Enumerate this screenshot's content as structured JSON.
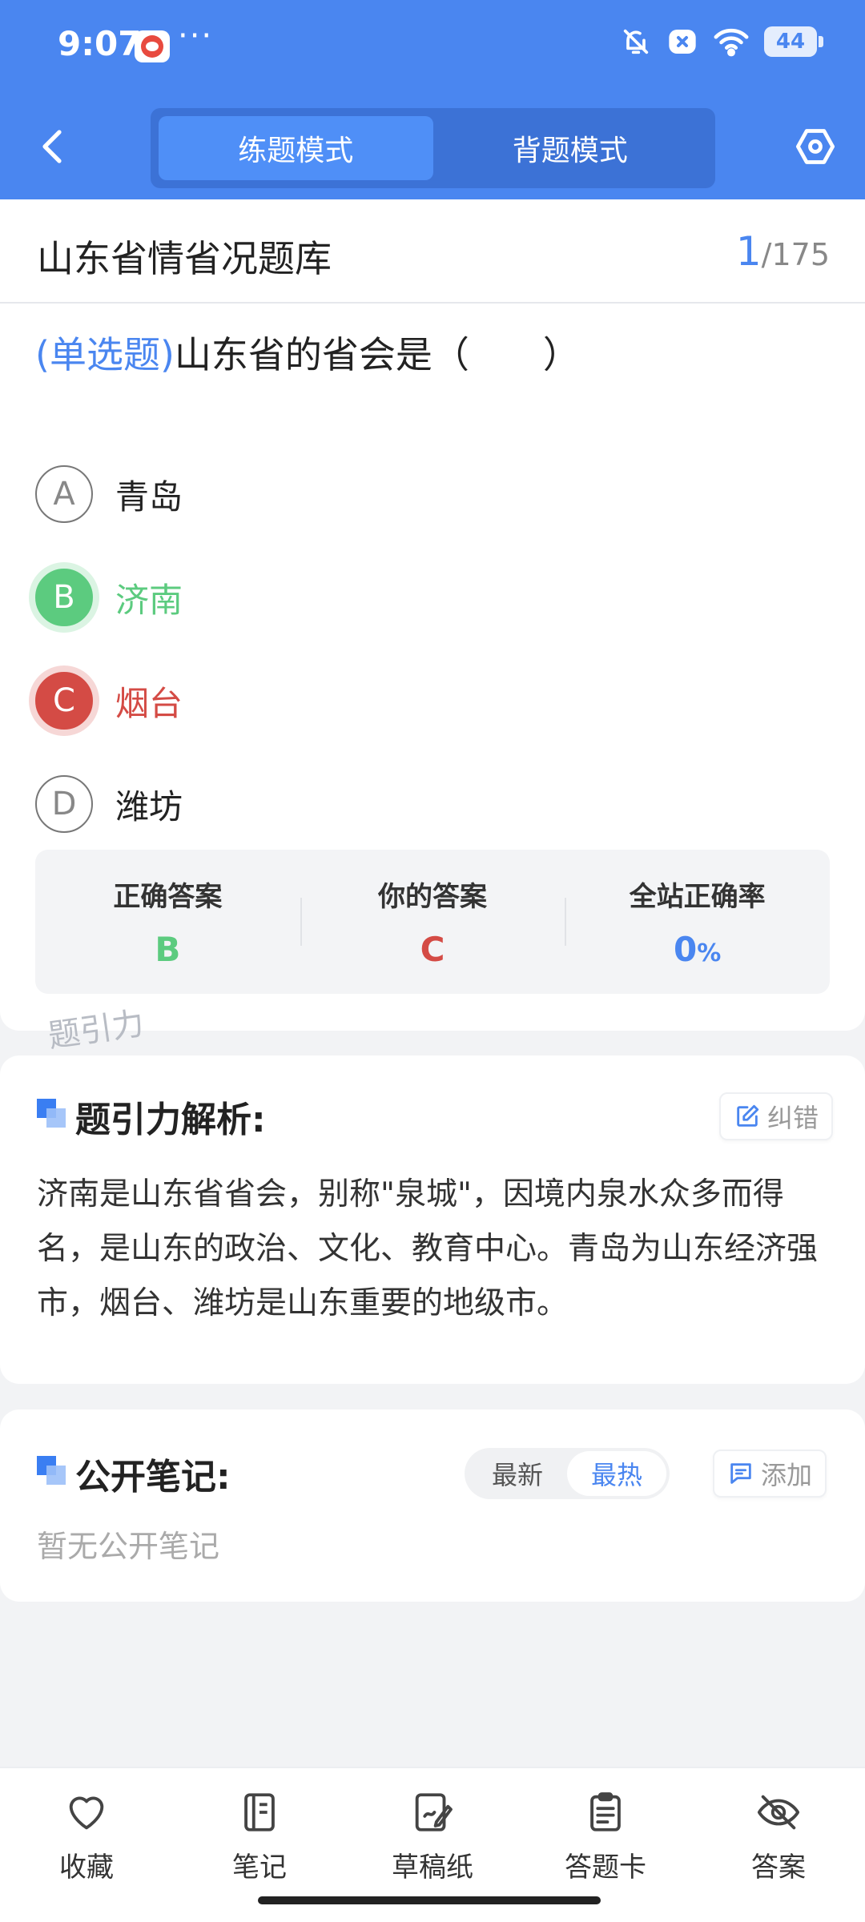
{
  "status_bar": {
    "time": "9:07",
    "more": "···",
    "battery": "44"
  },
  "nav": {
    "tabs": [
      {
        "label": "练题模式",
        "active": true
      },
      {
        "label": "背题模式",
        "active": false
      }
    ]
  },
  "bank": {
    "title": "山东省情省况题库",
    "current": "1",
    "total": "/175"
  },
  "question": {
    "type": "(单选题)",
    "text": "山东省的省会是（　　）",
    "options": [
      {
        "letter": "A",
        "text": "青岛",
        "state": "normal"
      },
      {
        "letter": "B",
        "text": "济南",
        "state": "correct"
      },
      {
        "letter": "C",
        "text": "烟台",
        "state": "wrong"
      },
      {
        "letter": "D",
        "text": "潍坊",
        "state": "normal"
      }
    ]
  },
  "stats": {
    "correct_label": "正确答案",
    "correct_value": "B",
    "yours_label": "你的答案",
    "yours_value": "C",
    "rate_label": "全站正确率",
    "rate_value": "0",
    "rate_unit": "%"
  },
  "watermark": "题引力",
  "analysis": {
    "title": "题引力解析:",
    "report_label": "纠错",
    "text": "济南是山东省省会，别称\"泉城\"，因境内泉水众多而得名，是山东的政治、文化、教育中心。青岛为山东经济强市，烟台、潍坊是山东重要的地级市。"
  },
  "notes": {
    "title": "公开笔记:",
    "sort_options": [
      {
        "label": "最新",
        "active": false
      },
      {
        "label": "最热",
        "active": true
      }
    ],
    "add_label": "添加",
    "empty_text": "暂无公开笔记"
  },
  "bottom_bar": {
    "items": [
      {
        "label": "收藏",
        "icon": "heart-icon"
      },
      {
        "label": "笔记",
        "icon": "notebook-icon"
      },
      {
        "label": "草稿纸",
        "icon": "draft-icon"
      },
      {
        "label": "答题卡",
        "icon": "clipboard-icon"
      },
      {
        "label": "答案",
        "icon": "eye-off-icon"
      }
    ]
  },
  "colors": {
    "primary": "#4a86f0",
    "correct": "#5ccb7f",
    "wrong": "#d44b45"
  }
}
